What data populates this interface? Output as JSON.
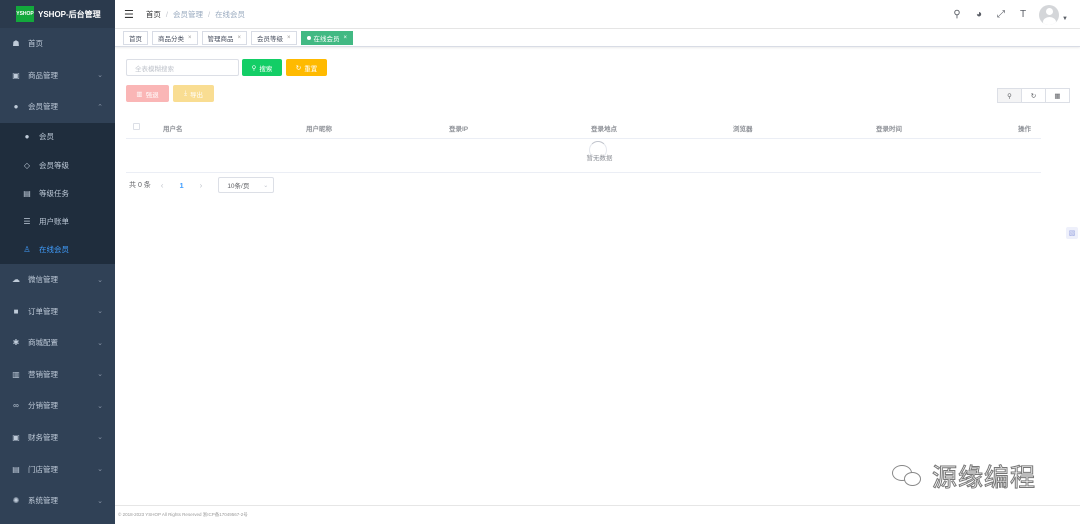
{
  "app": {
    "logo_mark": "YSHOP",
    "title": "YSHOP-后台管理"
  },
  "sidebar": {
    "items": [
      {
        "label": "首页",
        "icon": "dashboard-icon"
      },
      {
        "label": "商品管理",
        "icon": "goods-icon"
      },
      {
        "label": "会员管理",
        "icon": "members-icon"
      },
      {
        "label": "微信管理",
        "icon": "wechat-icon"
      },
      {
        "label": "订单管理",
        "icon": "lock-icon"
      },
      {
        "label": "商城配置",
        "icon": "gear-icon"
      },
      {
        "label": "营销管理",
        "icon": "chart-icon"
      },
      {
        "label": "分销管理",
        "icon": "share-icon"
      },
      {
        "label": "财务管理",
        "icon": "finance-icon"
      },
      {
        "label": "门店管理",
        "icon": "store-icon"
      },
      {
        "label": "系统管理",
        "icon": "system-icon"
      }
    ],
    "submenu": [
      {
        "label": "会员",
        "icon": "user-icon"
      },
      {
        "label": "会员等级",
        "icon": "level-icon"
      },
      {
        "label": "等级任务",
        "icon": "task-icon"
      },
      {
        "label": "用户账单",
        "icon": "list-icon"
      },
      {
        "label": "在线会员",
        "icon": "online-user-icon"
      }
    ]
  },
  "breadcrumb": [
    "首页",
    "会员管理",
    "在线会员"
  ],
  "tags": [
    {
      "label": "首页"
    },
    {
      "label": "商品分类"
    },
    {
      "label": "管理商品"
    },
    {
      "label": "会员等级"
    },
    {
      "label": "在线会员"
    }
  ],
  "toolbar": {
    "search_placeholder": "全表模糊搜索",
    "search_label": "搜索",
    "reset_label": "重置",
    "delete_label": "强退",
    "export_label": "导出"
  },
  "table": {
    "columns": [
      "用户名",
      "用户昵称",
      "登录IP",
      "登录地点",
      "浏览器",
      "登录时间",
      "操作"
    ],
    "empty_text": "暂无数据"
  },
  "pagination": {
    "total_text": "共 0 条",
    "current_page": "1",
    "page_size": "10条/页"
  },
  "footer": {
    "text": "© 2018-2023 YSHOP All Rights Reserved   浙ICP备17049567-2号"
  },
  "watermark": {
    "text": "源缘编程"
  }
}
